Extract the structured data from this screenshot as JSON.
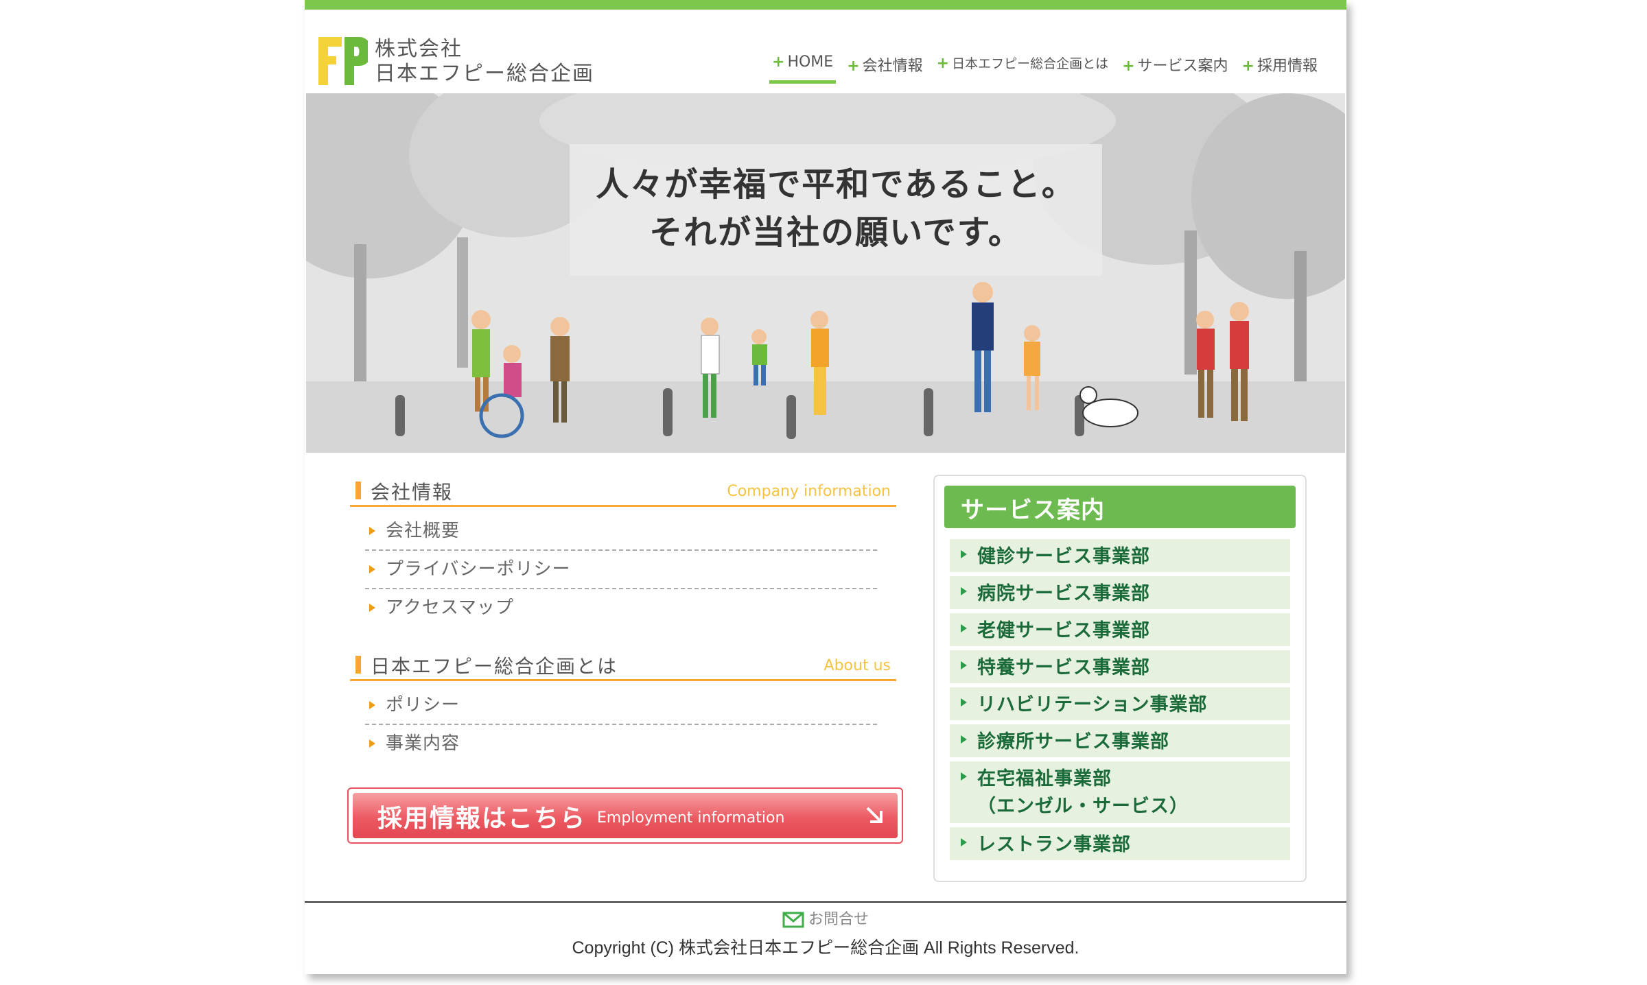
{
  "header": {
    "logo_line1": "株式会社",
    "logo_line2": "日本エフピー総合企画",
    "nav": [
      {
        "label": "HOME"
      },
      {
        "label": "会社情報"
      },
      {
        "label": "日本エフピー総合企画とは"
      },
      {
        "label": "サービス案内"
      },
      {
        "label": "採用情報"
      }
    ]
  },
  "hero": {
    "line1": "人々が幸福で平和であること。",
    "line2": "それが当社の願いです。"
  },
  "company": {
    "title": "会社情報",
    "title_en": "Company information",
    "links": [
      "会社概要",
      "プライバシーポリシー",
      "アクセスマップ"
    ]
  },
  "about": {
    "title": "日本エフピー総合企画とは",
    "title_en": "About us",
    "links": [
      "ポリシー",
      "事業内容"
    ]
  },
  "recruit": {
    "label": "採用情報はこちら",
    "label_en": "Employment information"
  },
  "services": {
    "title": "サービス案内",
    "items": [
      "健診サービス事業部",
      "病院サービス事業部",
      "老健サービス事業部",
      "特養サービス事業部",
      "リハビリテーション事業部",
      "診療所サービス事業部",
      "在宅福祉事業部",
      "（エンゼル・サービス）",
      "レストラン事業部"
    ]
  },
  "footer": {
    "contact": "お問合せ",
    "copyright": "Copyright (C) 株式会社日本エフピー総合企画 All Rights Reserved."
  },
  "colors": {
    "accent_green": "#7cc84a",
    "accent_orange": "#f7a733",
    "recruit_red": "#e8505b",
    "service_text": "#1b6b3a"
  }
}
